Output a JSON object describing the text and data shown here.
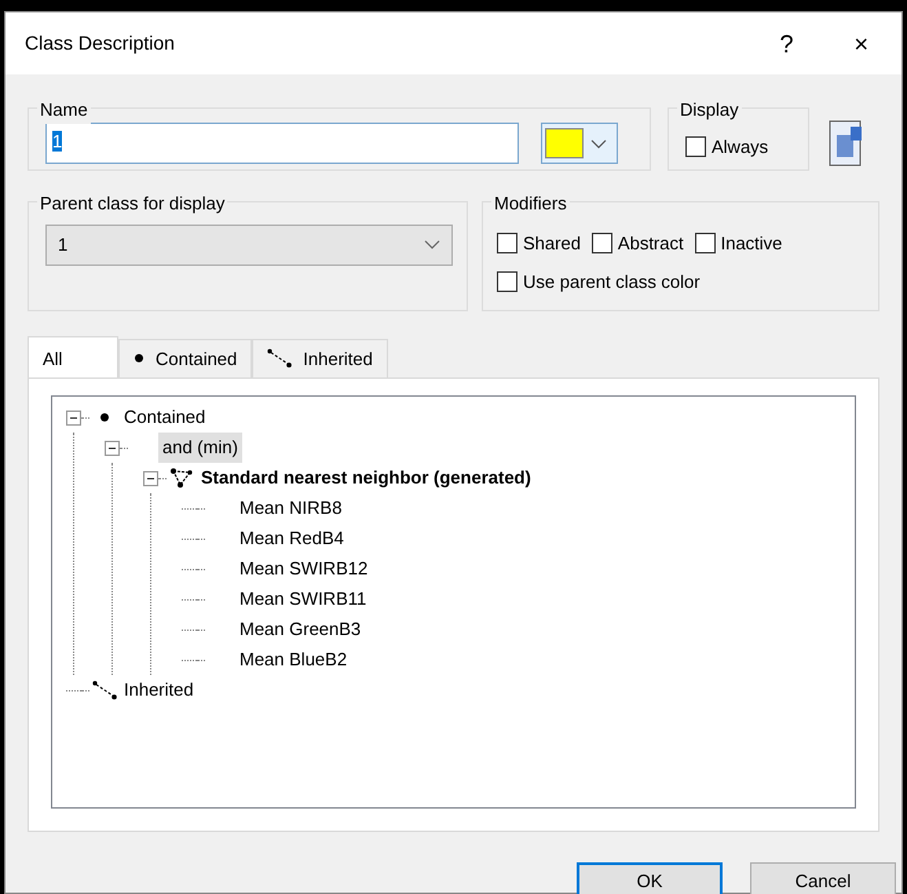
{
  "window": {
    "title": "Class Description",
    "help": "?",
    "close": "×"
  },
  "name_group": {
    "label": "Name",
    "value": "1",
    "color": "#ffff00"
  },
  "display_group": {
    "label": "Display",
    "always": {
      "label": "Always",
      "checked": false
    }
  },
  "parent_group": {
    "label": "Parent class for display",
    "value": "1"
  },
  "modifiers": {
    "label": "Modifiers",
    "options": [
      {
        "label": "Shared",
        "checked": false
      },
      {
        "label": "Abstract",
        "checked": false
      },
      {
        "label": "Inactive",
        "checked": false
      },
      {
        "label": "Use parent class color",
        "checked": false
      }
    ]
  },
  "tabs": [
    {
      "label": "All",
      "selected": true
    },
    {
      "label": "Contained",
      "kind": "contained",
      "selected": false
    },
    {
      "label": "Inherited",
      "kind": "inherited",
      "selected": false
    }
  ],
  "tree": [
    {
      "label": "Contained",
      "kind": "contained",
      "bold": false,
      "selected": false,
      "expanded": true,
      "children": [
        {
          "label": "and (min)",
          "bold": false,
          "selected": true,
          "expanded": true,
          "children": [
            {
              "label": "Standard nearest neighbor (generated)",
              "kind": "classifier",
              "bold": true,
              "selected": false,
              "expanded": true,
              "children": [
                {
                  "label": "Mean NIRB8",
                  "bold": false,
                  "selected": false
                },
                {
                  "label": "Mean RedB4",
                  "bold": false,
                  "selected": false
                },
                {
                  "label": "Mean SWIRB12",
                  "bold": false,
                  "selected": false
                },
                {
                  "label": "Mean SWIRB11",
                  "bold": false,
                  "selected": false
                },
                {
                  "label": "Mean GreenB3",
                  "bold": false,
                  "selected": false
                },
                {
                  "label": "Mean BlueB2",
                  "bold": false,
                  "selected": false
                }
              ]
            }
          ]
        }
      ]
    },
    {
      "label": "Inherited",
      "kind": "inherited",
      "bold": false,
      "selected": false
    }
  ],
  "buttons": [
    {
      "label": "OK",
      "default": true
    },
    {
      "label": "Cancel",
      "default": false
    }
  ]
}
